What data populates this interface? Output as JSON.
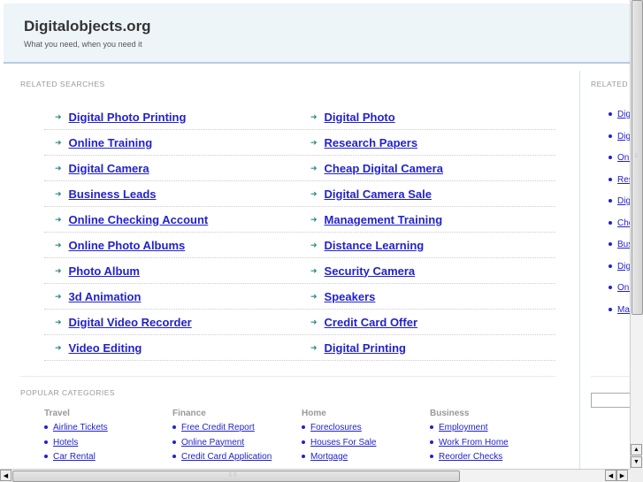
{
  "header": {
    "title": "Digitalobjects.org",
    "tagline": "What you need, when you need it"
  },
  "related": {
    "label": "RELATED SEARCHES",
    "left": [
      "Digital Photo Printing",
      "Online Training",
      "Digital Camera",
      "Business Leads",
      "Online Checking Account",
      "Online Photo Albums",
      "Photo Album",
      "3d Animation",
      "Digital Video Recorder",
      "Video Editing"
    ],
    "right": [
      "Digital Photo",
      "Research Papers",
      "Cheap Digital Camera",
      "Digital Camera Sale",
      "Management Training",
      "Distance Learning",
      "Security Camera",
      "Speakers",
      "Credit Card Offer",
      "Digital Printing"
    ]
  },
  "sidebar": {
    "label": "RELATED",
    "items": [
      "Digital Photo Printing",
      "Digital Photo",
      "Online Training",
      "Research Papers",
      "Digital Camera",
      "Cheap Digital Camera",
      "Business Leads",
      "Digital Camera Sale",
      "Online Checking Account",
      "Management Training"
    ]
  },
  "popular": {
    "label": "POPULAR CATEGORIES",
    "categories": [
      {
        "title": "Travel",
        "items": [
          "Airline Tickets",
          "Hotels",
          "Car Rental"
        ]
      },
      {
        "title": "Finance",
        "items": [
          "Free Credit Report",
          "Online Payment",
          "Credit Card Application"
        ]
      },
      {
        "title": "Home",
        "items": [
          "Foreclosures",
          "Houses For Sale",
          "Mortgage"
        ]
      },
      {
        "title": "Business",
        "items": [
          "Employment",
          "Work From Home",
          "Reorder Checks"
        ]
      }
    ]
  }
}
